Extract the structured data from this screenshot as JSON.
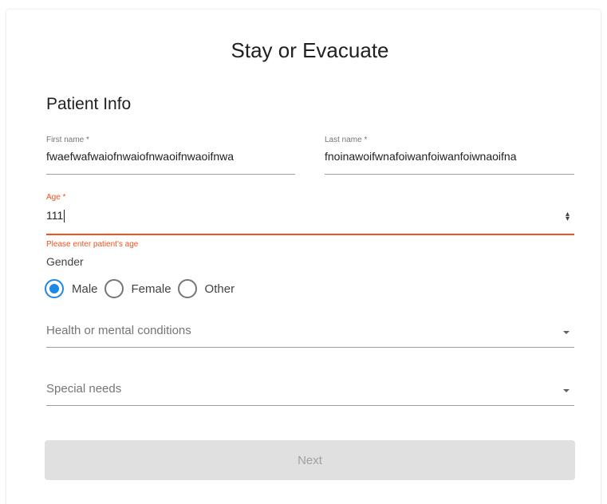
{
  "header": {
    "title": "Stay or Evacuate"
  },
  "section": {
    "title": "Patient Info"
  },
  "form": {
    "first_name": {
      "label": "First name *",
      "value": "fwaefwafwaiofnwaiofnwaoifnwaoifnwa"
    },
    "last_name": {
      "label": "Last name *",
      "value": "fnoinawoifwnafoiwanfoiwanfoiwnaoifna"
    },
    "age": {
      "label": "Age *",
      "value": "111",
      "error": "Please enter patient's age"
    },
    "gender": {
      "label": "Gender",
      "options": [
        "Male",
        "Female",
        "Other"
      ],
      "selected": "Male"
    },
    "health_conditions": {
      "placeholder": "Health or mental conditions"
    },
    "special_needs": {
      "placeholder": "Special needs"
    }
  },
  "actions": {
    "next_label": "Next"
  },
  "colors": {
    "accent": "#1e88e5",
    "error": "#f4511e",
    "disabled_bg": "#e0e0e0"
  },
  "icons": {
    "spinner": "updown-spinner-icon",
    "dropdown": "dropdown-arrow-icon"
  }
}
